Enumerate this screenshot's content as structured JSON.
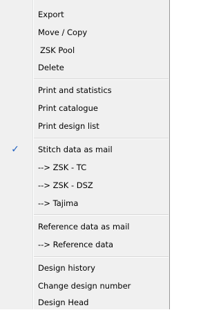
{
  "menu": {
    "items": [
      {
        "label": "Export"
      },
      {
        "label": "Move / Copy"
      },
      {
        "label": "ZSK Pool"
      },
      {
        "label": "Delete"
      },
      {
        "label": "Print and statistics"
      },
      {
        "label": "Print catalogue"
      },
      {
        "label": "Print design list"
      },
      {
        "label": "Stitch data as mail",
        "checked": true,
        "check_icon": "checkmark-icon",
        "check_glyph": "✓"
      },
      {
        "label": "-->  ZSK - TC"
      },
      {
        "label": "-->  ZSK - DSZ"
      },
      {
        "label": "-->  Tajima"
      },
      {
        "label": "Reference data as mail"
      },
      {
        "label": "-->  Reference data"
      },
      {
        "label": "Design history"
      },
      {
        "label": "Change design number"
      },
      {
        "label": "Design Head"
      }
    ]
  }
}
